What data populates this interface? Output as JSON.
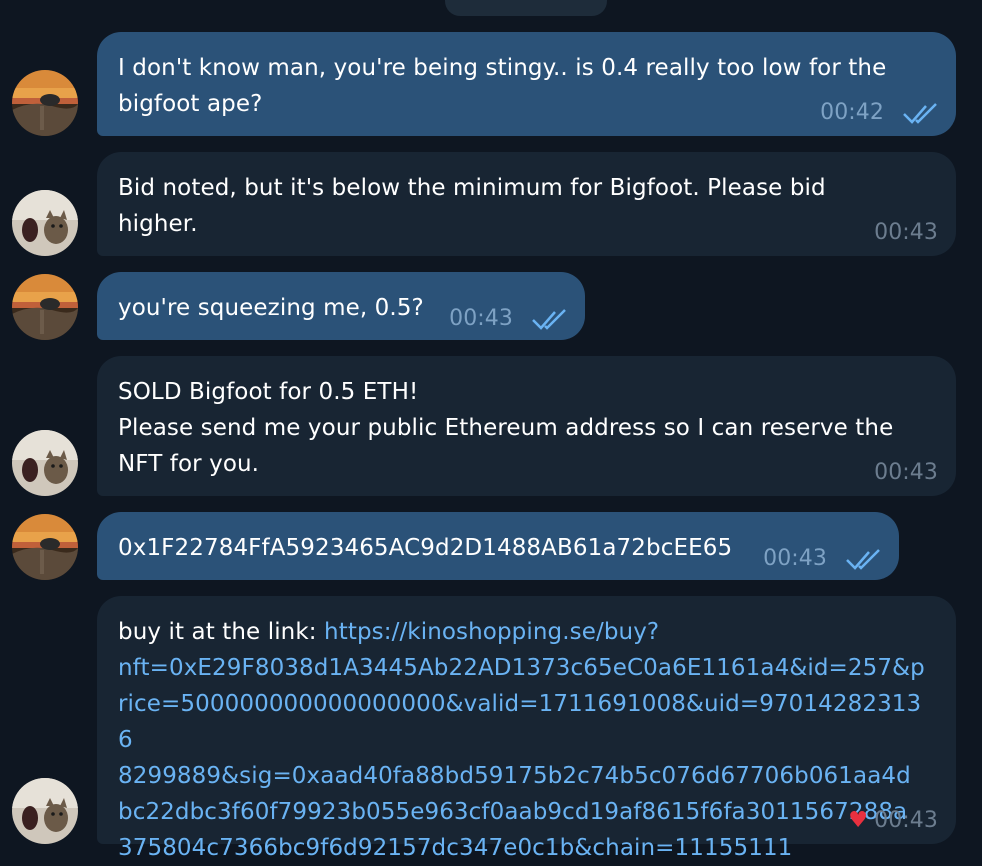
{
  "colors": {
    "background": "#0e1621",
    "outgoing_bubble": "#2b5278",
    "incoming_bubble": "#182533",
    "link": "#6ab3f3",
    "read_ticks": "#6ab3f3"
  },
  "messages": [
    {
      "direction": "outgoing",
      "text": "I don't know man, you're being stingy.. is 0.4 really too low for the\nbigfoot ape?",
      "time": "00:42",
      "status": "read",
      "avatar": "sunset-bird-avatar"
    },
    {
      "direction": "incoming",
      "text": "Bid noted, but it's below the minimum for Bigfoot. Please bid\nhigher.",
      "time": "00:43",
      "avatar": "cat-avatar"
    },
    {
      "direction": "outgoing",
      "text": "you're squeezing me, 0.5?",
      "time": "00:43",
      "status": "read",
      "avatar": "sunset-bird-avatar"
    },
    {
      "direction": "incoming",
      "text": "SOLD Bigfoot for 0.5 ETH!\nPlease send me your public Ethereum address so I can reserve the\nNFT for you.",
      "time": "00:43",
      "avatar": "cat-avatar"
    },
    {
      "direction": "outgoing",
      "text": "0x1F22784FfA5923465AC9d2D1488AB61a72bcEE65",
      "time": "00:43",
      "status": "read",
      "avatar": "sunset-bird-avatar"
    },
    {
      "direction": "incoming",
      "prefix": "buy it at the link: ",
      "link": "https://kinoshopping.se/buy?\nnft=0xE29F8038d1A3445Ab22AD1373c65eC0a6E1161a4&id=257&p\nrice=500000000000000000&valid=1711691008&uid=970142823136\n8299889&sig=0xaad40fa88bd59175b2c74b5c076d67706b061aa4d\nbc22dbc3f60f79923b055e963cf0aab9cd19af8615f6fa3011567288a\n375804c7366bc9f6d92157dc347e0c1b&chain=11155111",
      "time": "00:43",
      "reaction": "♥",
      "avatar": "cat-avatar"
    }
  ]
}
